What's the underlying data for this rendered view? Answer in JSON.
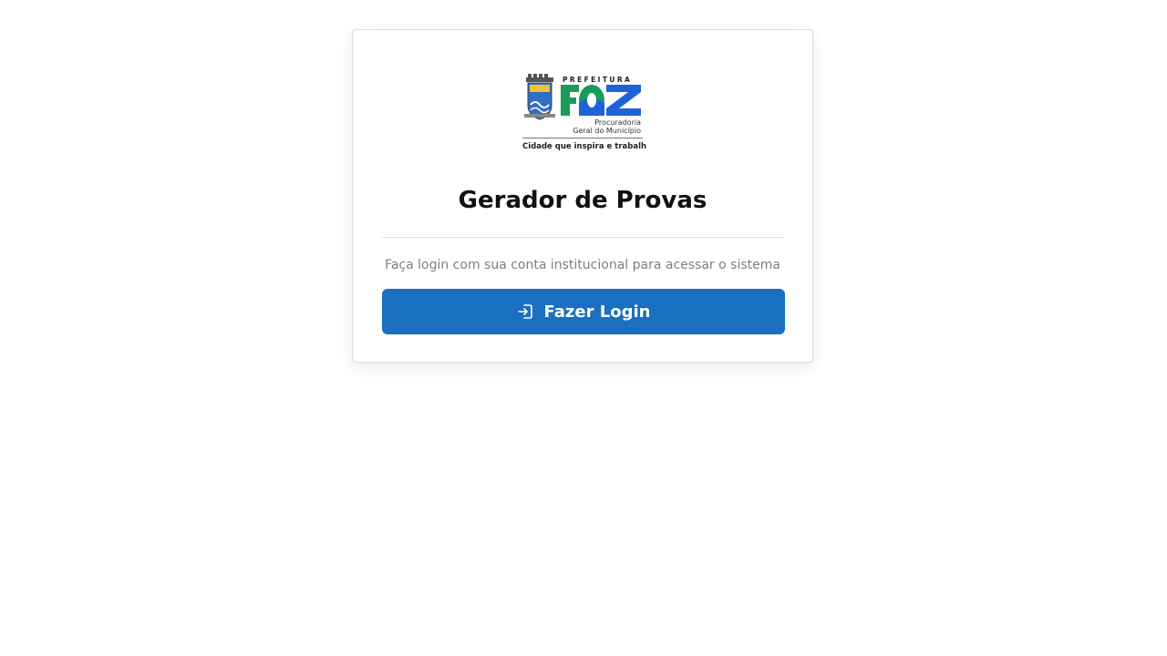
{
  "logo": {
    "prefeitura": "PREFEITURA",
    "foz": "FOZ",
    "line1": "Procuradoria",
    "line2": "Geral do Município",
    "tagline": "Cidade que inspira e trabalha"
  },
  "title": "Gerador de Provas",
  "subtitle": "Faça login com sua conta institucional para acessar o sistema",
  "login_button": {
    "label": "Fazer Login",
    "icon": "login-icon"
  },
  "colors": {
    "primary": "#1a6fc1",
    "foz_green": "#1a9b5a",
    "foz_blue": "#1f63d6"
  }
}
